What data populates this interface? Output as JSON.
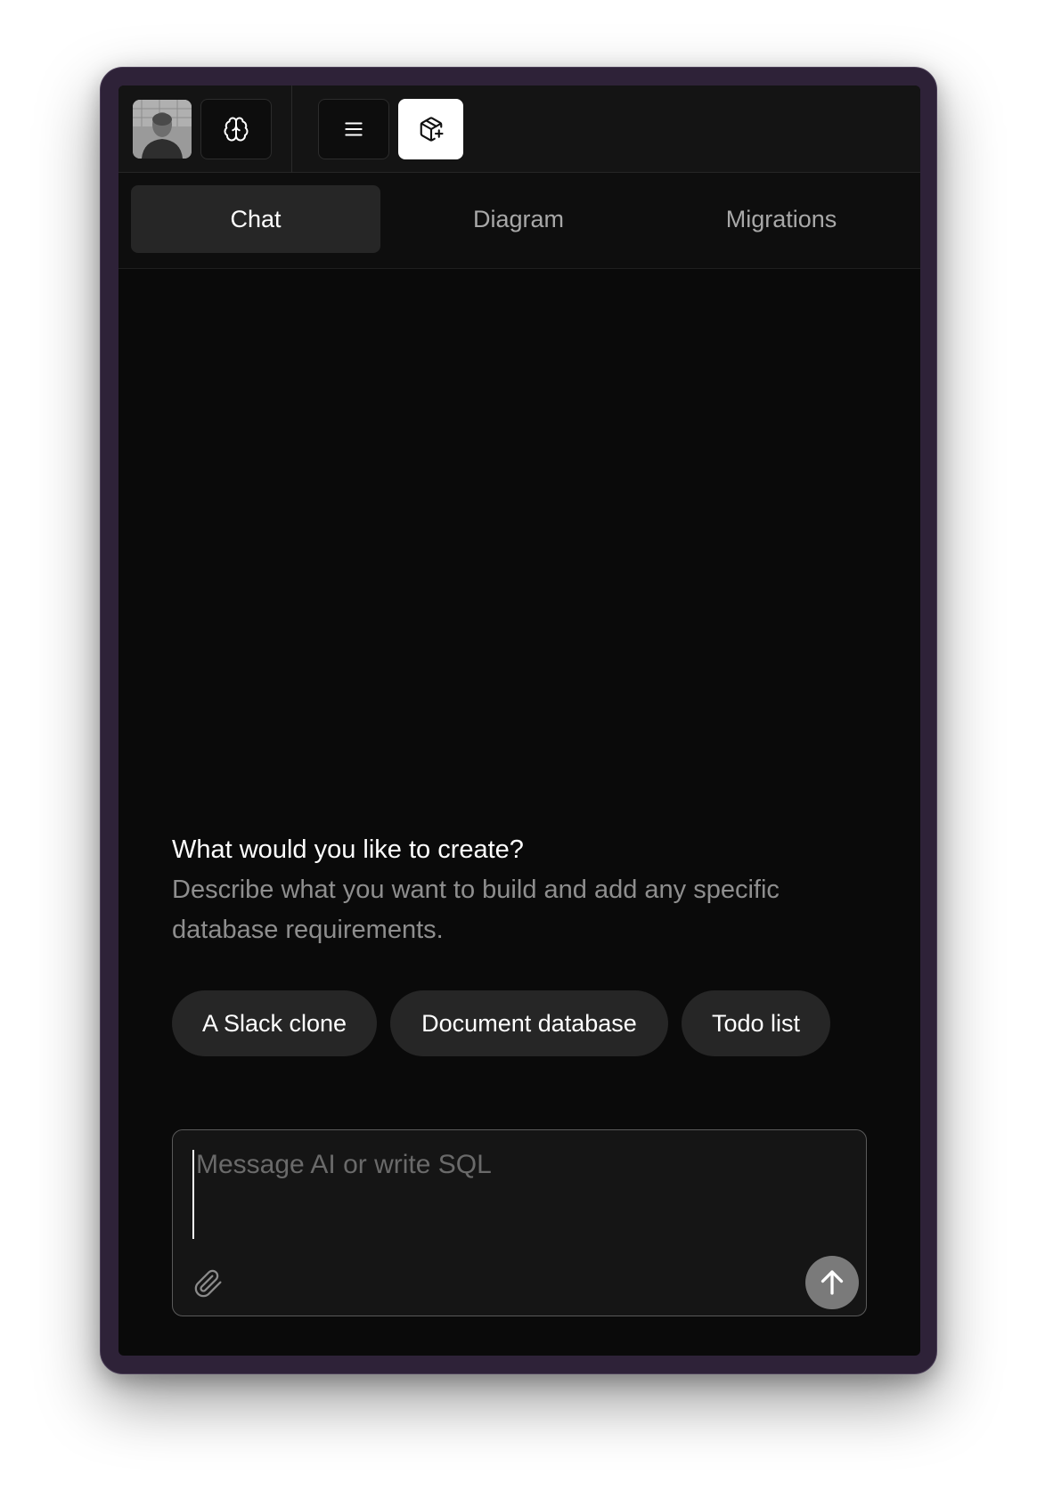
{
  "topbar": {
    "avatar": {
      "icon": "user-avatar"
    },
    "buttons": [
      {
        "icon": "brain-icon",
        "active": false
      },
      {
        "icon": "menu-icon",
        "active": false
      },
      {
        "icon": "package-plus-icon",
        "active": true
      }
    ]
  },
  "tabs": [
    {
      "label": "Chat",
      "active": true
    },
    {
      "label": "Diagram",
      "active": false
    },
    {
      "label": "Migrations",
      "active": false
    }
  ],
  "prompt": {
    "title": "What would you like to create?",
    "description": "Describe what you want to build and add any specific database requirements."
  },
  "suggestions": [
    {
      "label": "A Slack clone"
    },
    {
      "label": "Document database"
    },
    {
      "label": "Todo list"
    }
  ],
  "composer": {
    "placeholder": "Message AI or write SQL",
    "value": "",
    "attach_icon": "paperclip-icon",
    "send_icon": "arrow-up-icon"
  },
  "colors": {
    "window_frame": "#2e2238",
    "app_background": "#0a0a0a",
    "active_tab": "#262626",
    "chip_background": "#262626",
    "send_button": "#7a7a7a"
  }
}
